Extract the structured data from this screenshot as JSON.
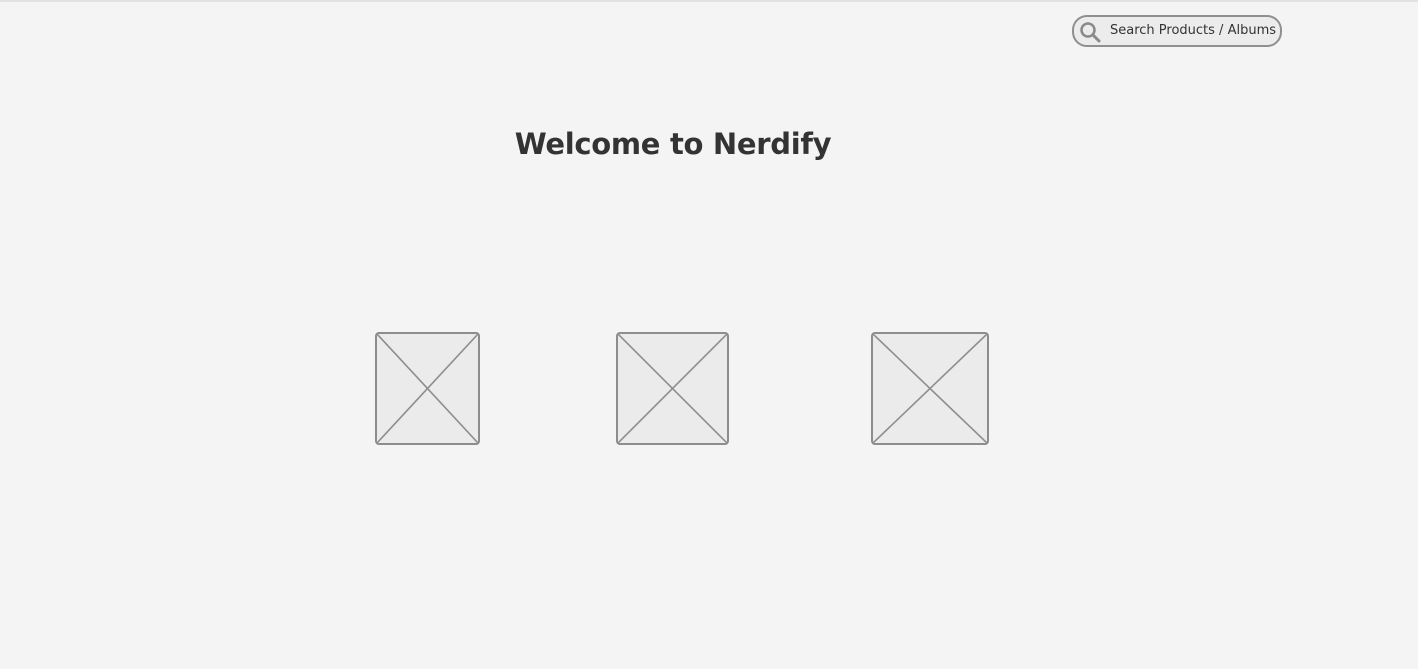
{
  "header": {
    "search": {
      "placeholder": "Search Products / Albums",
      "icon": "search-icon"
    }
  },
  "main": {
    "title": "Welcome to Nerdify",
    "images": [
      {
        "icon": "image-placeholder-icon"
      },
      {
        "icon": "image-placeholder-icon"
      },
      {
        "icon": "image-placeholder-icon"
      }
    ]
  }
}
